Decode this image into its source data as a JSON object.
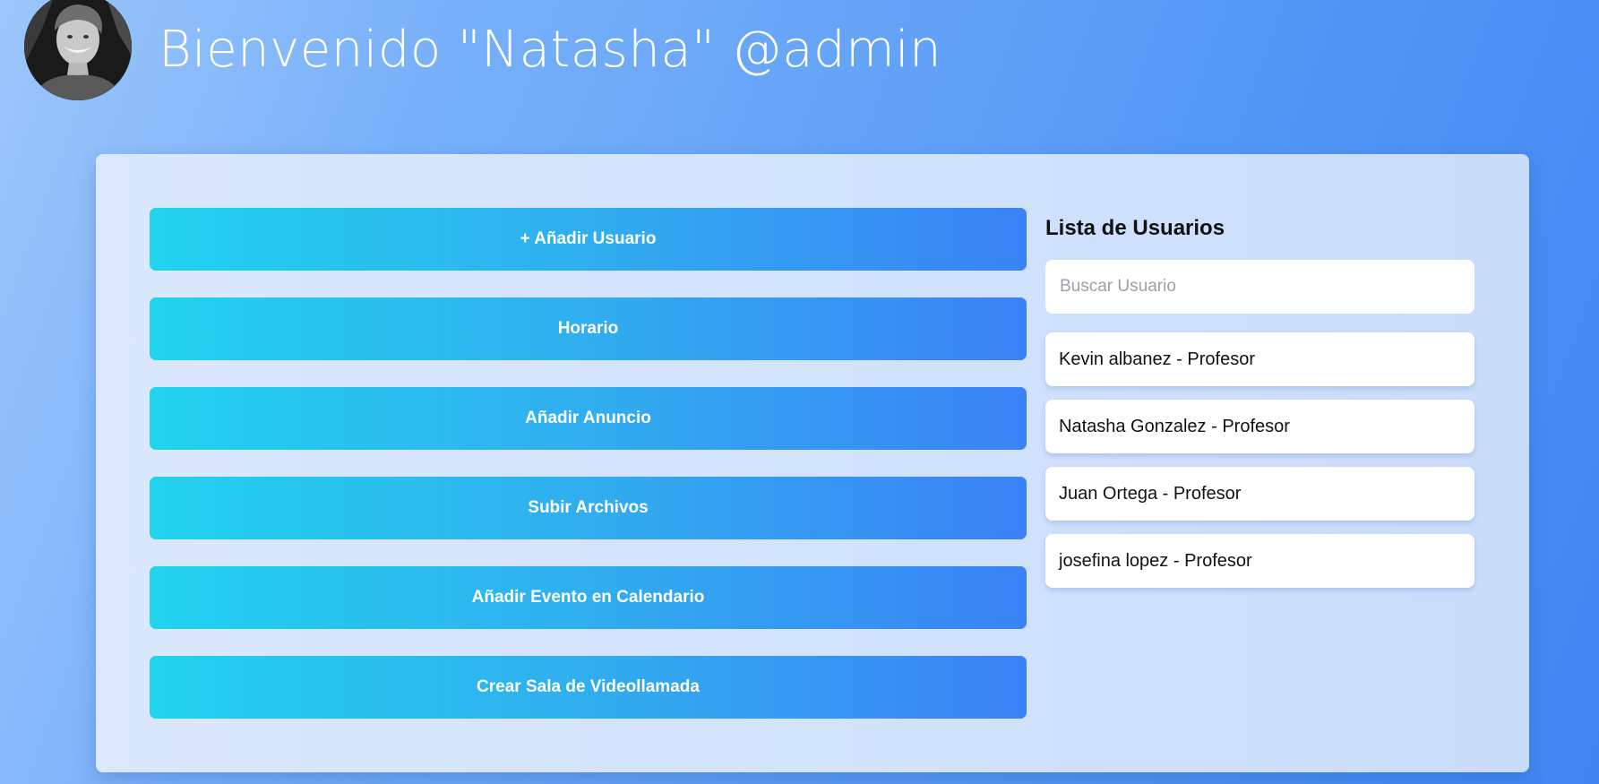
{
  "header": {
    "welcome_text": "Bienvenido \"Natasha\" @admin",
    "avatar_icon": "user-avatar-photo"
  },
  "actions": [
    {
      "label": "+ Añadir Usuario"
    },
    {
      "label": "Horario"
    },
    {
      "label": "Añadir Anuncio"
    },
    {
      "label": "Subir Archivos"
    },
    {
      "label": "Añadir Evento en Calendario"
    },
    {
      "label": "Crear Sala de Videollamada"
    }
  ],
  "users": {
    "title": "Lista de Usuarios",
    "search_placeholder": "Buscar Usuario",
    "search_value": "",
    "items": [
      {
        "label": "Kevin albanez - Profesor"
      },
      {
        "label": "Natasha Gonzalez - Profesor"
      },
      {
        "label": "Juan Ortega - Profesor"
      },
      {
        "label": "josefina lopez - Profesor"
      }
    ]
  },
  "colors": {
    "button_gradient_start": "#22d3ee",
    "button_gradient_end": "#3b82f6",
    "background_start": "#9cc6fb",
    "background_end": "#3f86f2"
  }
}
